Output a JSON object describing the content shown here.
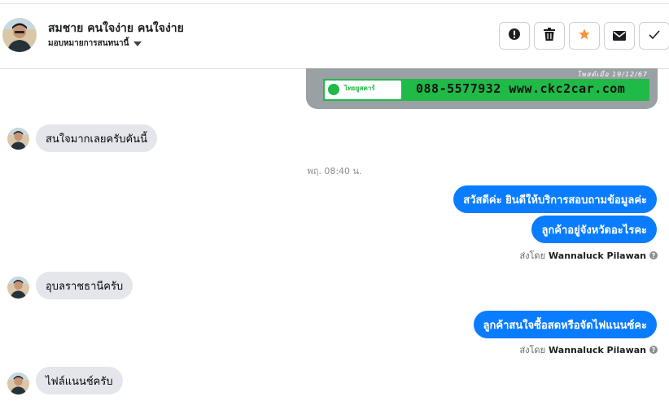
{
  "header": {
    "contact_name": "สมชาย คนใจง่าย คนใจง่าย",
    "assign_label": "มอบหมายการสนทนานี้",
    "actions": [
      {
        "icon": "alert-icon",
        "name": "mark-spam-button"
      },
      {
        "icon": "trash-icon",
        "name": "delete-button"
      },
      {
        "icon": "star-icon",
        "name": "star-button"
      },
      {
        "icon": "envelope-icon",
        "name": "mark-unread-button"
      },
      {
        "icon": "check-icon",
        "name": "mark-done-button"
      }
    ],
    "star_color": "#f7923b"
  },
  "banner": {
    "date_text": "โพสต์เมื่อ 19/12/67",
    "logo_text": "ไทยยูสคาร์",
    "contact_text": "088-5577932 www.ckc2car.com",
    "strip_color": "#1fba47"
  },
  "messages": [
    {
      "direction": "in",
      "text": "สนใจมากเลยครับคันนี้"
    },
    {
      "type": "time",
      "text": "พฤ. 08:40 น."
    },
    {
      "direction": "out",
      "text": "สวัสดีค่ะ  ยินดีให้บริการสอบถามข้อมูลค่ะ"
    },
    {
      "direction": "out",
      "text": "ลูกค้าอยู่จังหวัดอะไรคะ"
    },
    {
      "type": "sent_by",
      "prefix": "ส่งโดย",
      "agent": "Wannaluck Pilawan"
    },
    {
      "direction": "in",
      "text": "อุบลราชธานีครับ"
    },
    {
      "direction": "out",
      "text": "ลูกค้าสนใจซื้อสดหรือจัดไฟแนนซ์คะ"
    },
    {
      "type": "sent_by",
      "prefix": "ส่งโดย",
      "agent": "Wannaluck Pilawan"
    },
    {
      "direction": "in",
      "text": "ไฟล์แนนช์ครับ"
    }
  ],
  "colors": {
    "outgoing_bubble": "#0a7cff",
    "incoming_bubble": "#e4e6eb"
  }
}
